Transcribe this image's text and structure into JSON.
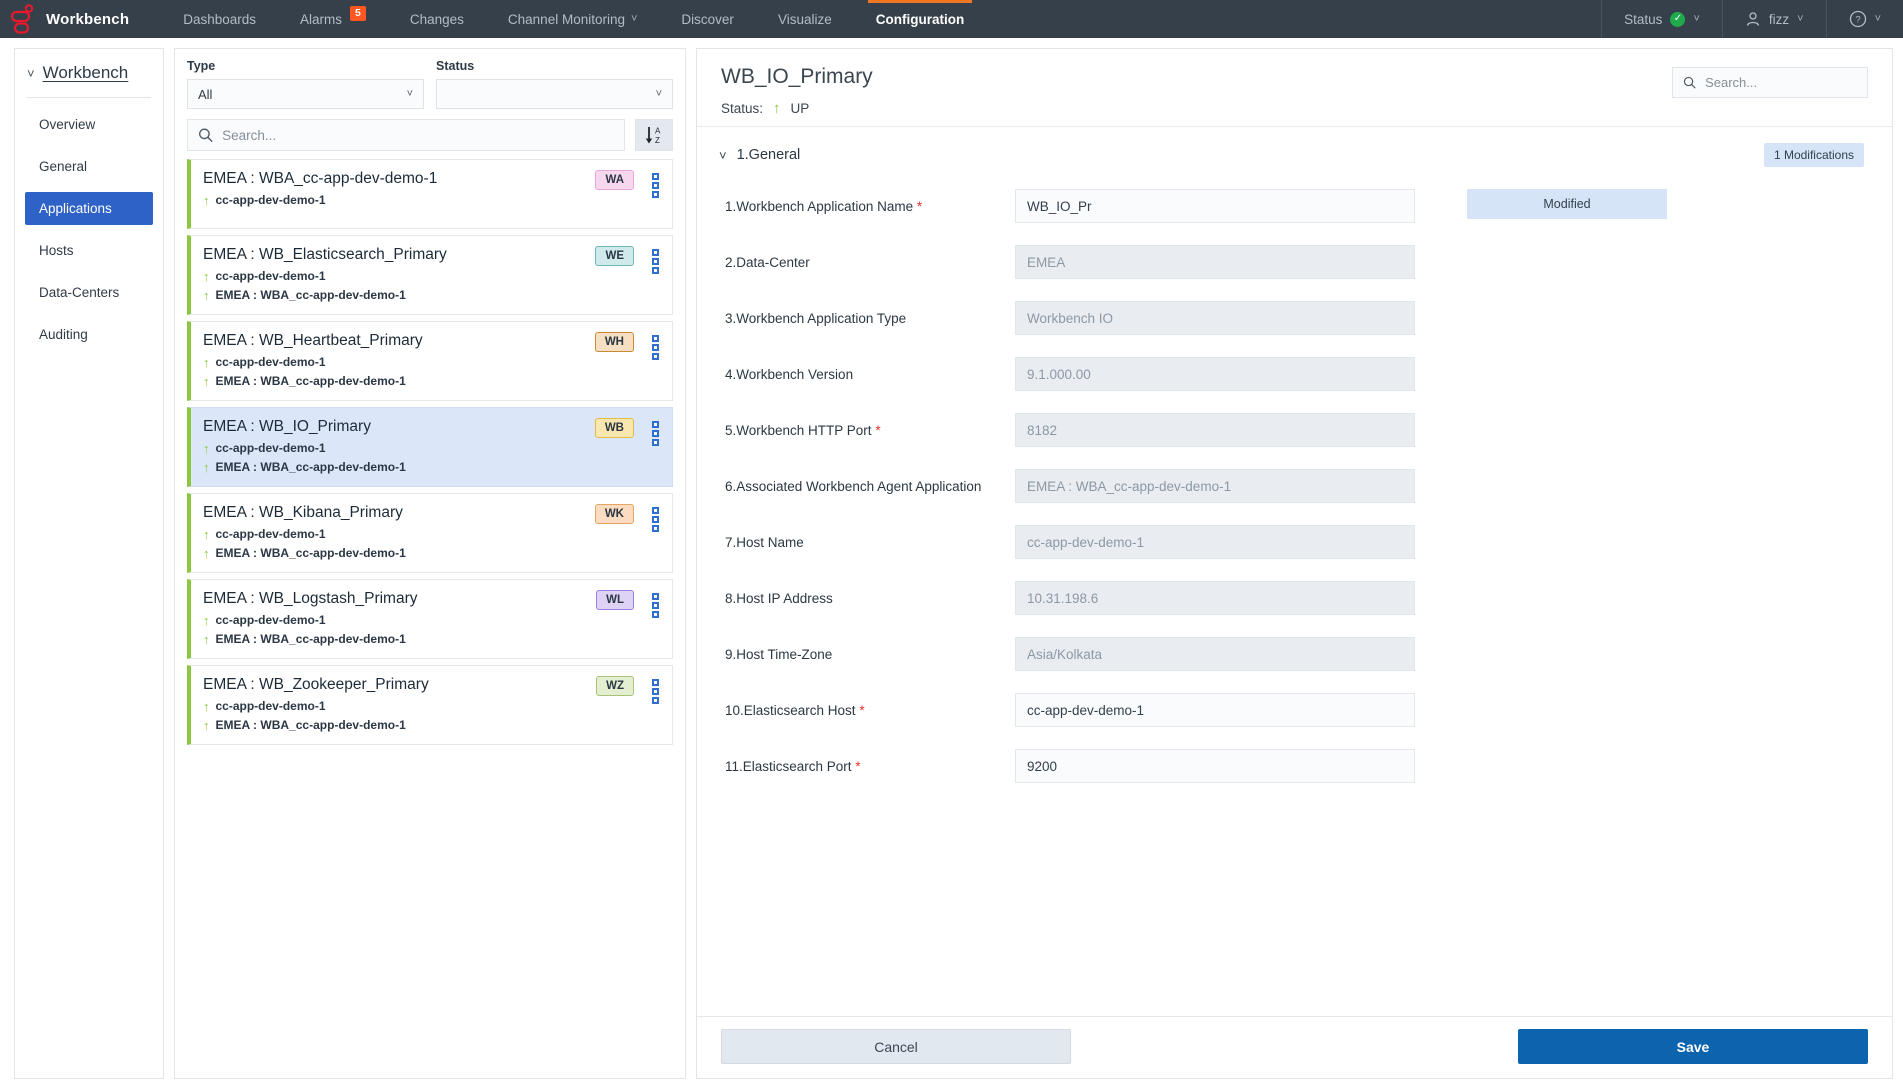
{
  "topnav": {
    "brand": "Workbench",
    "items": [
      {
        "label": "Dashboards",
        "active": false,
        "caret": false,
        "badge": null
      },
      {
        "label": "Alarms",
        "active": false,
        "caret": false,
        "badge": "5"
      },
      {
        "label": "Changes",
        "active": false,
        "caret": false,
        "badge": null
      },
      {
        "label": "Channel Monitoring",
        "active": false,
        "caret": true,
        "badge": null
      },
      {
        "label": "Discover",
        "active": false,
        "caret": false,
        "badge": null
      },
      {
        "label": "Visualize",
        "active": false,
        "caret": false,
        "badge": null
      },
      {
        "label": "Configuration",
        "active": true,
        "caret": false,
        "badge": null
      }
    ],
    "status_label": "Status",
    "status_icon": "check-circle-icon",
    "user_label": "fizz",
    "user_icon": "user-icon",
    "help_icon": "help-circle-icon",
    "accent_color": "#ef7622",
    "bar_color": "#36404a"
  },
  "sidebar": {
    "title": "Workbench",
    "collapse_icon": "chevron-down-icon",
    "items": [
      {
        "label": "Overview",
        "active": false
      },
      {
        "label": "General",
        "active": false
      },
      {
        "label": "Applications",
        "active": true
      },
      {
        "label": "Hosts",
        "active": false
      },
      {
        "label": "Data-Centers",
        "active": false
      },
      {
        "label": "Auditing",
        "active": false
      }
    ],
    "active_color": "#2f62c7"
  },
  "list_panel": {
    "type_label": "Type",
    "type_value": "All",
    "status_label": "Status",
    "status_value": "",
    "search_placeholder": "Search...",
    "search_value": "",
    "sort_icon": "sort-alpha-asc-icon",
    "items": [
      {
        "name": "EMEA : WBA_cc-app-dev-demo-1",
        "sublines": [
          "cc-app-dev-demo-1"
        ],
        "badge": "WA",
        "badge_bg": "#f7d6ef",
        "badge_border": "#e9a7d9",
        "selected": false
      },
      {
        "name": "EMEA : WB_Elasticsearch_Primary",
        "sublines": [
          "cc-app-dev-demo-1",
          "EMEA : WBA_cc-app-dev-demo-1"
        ],
        "badge": "WE",
        "badge_bg": "#cfeaea",
        "badge_border": "#6fb8b8",
        "selected": false
      },
      {
        "name": "EMEA : WB_Heartbeat_Primary",
        "sublines": [
          "cc-app-dev-demo-1",
          "EMEA : WBA_cc-app-dev-demo-1"
        ],
        "badge": "WH",
        "badge_bg": "#f6dfc2",
        "badge_border": "#c98a37",
        "selected": false
      },
      {
        "name": "EMEA : WB_IO_Primary",
        "sublines": [
          "cc-app-dev-demo-1",
          "EMEA : WBA_cc-app-dev-demo-1"
        ],
        "badge": "WB",
        "badge_bg": "#fae7b0",
        "badge_border": "#e3bb48",
        "selected": true
      },
      {
        "name": "EMEA : WB_Kibana_Primary",
        "sublines": [
          "cc-app-dev-demo-1",
          "EMEA : WBA_cc-app-dev-demo-1"
        ],
        "badge": "WK",
        "badge_bg": "#fbdcc0",
        "badge_border": "#e8a262",
        "selected": false
      },
      {
        "name": "EMEA : WB_Logstash_Primary",
        "sublines": [
          "cc-app-dev-demo-1",
          "EMEA : WBA_cc-app-dev-demo-1"
        ],
        "badge": "WL",
        "badge_bg": "#ded2f5",
        "badge_border": "#9c7fe0",
        "selected": false
      },
      {
        "name": "EMEA : WB_Zookeeper_Primary",
        "sublines": [
          "cc-app-dev-demo-1",
          "EMEA : WBA_cc-app-dev-demo-1"
        ],
        "badge": "WZ",
        "badge_bg": "#e3efcf",
        "badge_border": "#a8c27a",
        "selected": false
      }
    ],
    "status_bar_color": "#8dc63f",
    "selected_bg": "#dbe7f8",
    "menu_icon": "three-dots-menu-icon"
  },
  "detail": {
    "title": "WB_IO_Primary",
    "status_label": "Status:",
    "status_value": "UP",
    "status_icon": "arrow-up-icon",
    "search_placeholder": "Search...",
    "search_value": "",
    "section": {
      "title": "1.General",
      "collapse_icon": "chevron-down-icon",
      "modifications_badge": "1 Modifications"
    },
    "fields": [
      {
        "label": "1.Workbench Application Name",
        "required": true,
        "value": "WB_IO_Pr",
        "readonly": false,
        "side_chip": "Modified"
      },
      {
        "label": "2.Data-Center",
        "required": false,
        "value": "EMEA",
        "readonly": true,
        "side_chip": null
      },
      {
        "label": "3.Workbench Application Type",
        "required": false,
        "value": "Workbench IO",
        "readonly": true,
        "side_chip": null
      },
      {
        "label": "4.Workbench Version",
        "required": false,
        "value": "9.1.000.00",
        "readonly": true,
        "side_chip": null
      },
      {
        "label": "5.Workbench HTTP Port",
        "required": true,
        "value": "8182",
        "readonly": true,
        "side_chip": null
      },
      {
        "label": "6.Associated Workbench Agent Application",
        "required": false,
        "value": "EMEA : WBA_cc-app-dev-demo-1",
        "readonly": true,
        "side_chip": null
      },
      {
        "label": "7.Host Name",
        "required": false,
        "value": "cc-app-dev-demo-1",
        "readonly": true,
        "side_chip": null
      },
      {
        "label": "8.Host IP Address",
        "required": false,
        "value": "10.31.198.6",
        "readonly": true,
        "side_chip": null
      },
      {
        "label": "9.Host Time-Zone",
        "required": false,
        "value": "Asia/Kolkata",
        "readonly": true,
        "side_chip": null
      },
      {
        "label": "10.Elasticsearch Host",
        "required": true,
        "value": "cc-app-dev-demo-1",
        "readonly": false,
        "side_chip": null
      },
      {
        "label": "11.Elasticsearch Port",
        "required": true,
        "value": "9200",
        "readonly": false,
        "side_chip": null
      }
    ],
    "cancel_label": "Cancel",
    "save_label": "Save",
    "save_color": "#0b64ad"
  }
}
